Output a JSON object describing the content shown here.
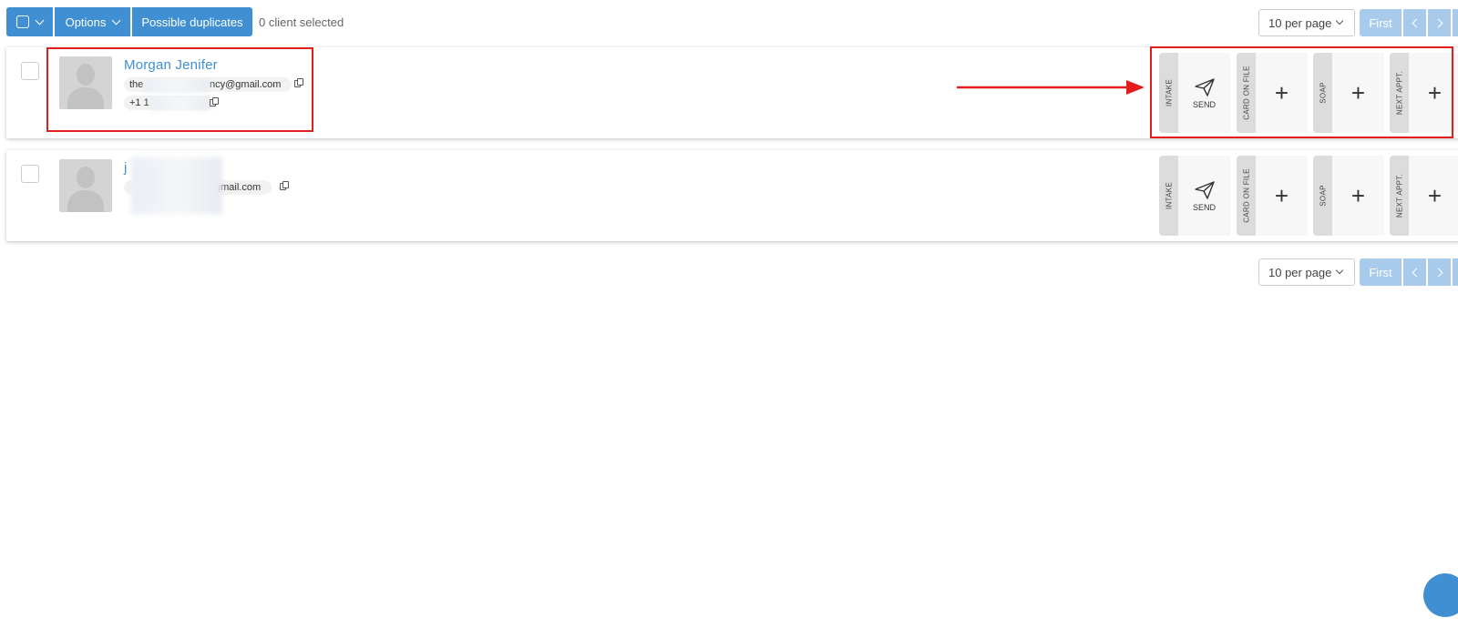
{
  "toolbar": {
    "options_label": "Options",
    "duplicates_label": "Possible duplicates",
    "selected_text": "0 client selected",
    "per_page": "10 per page",
    "first_label": "First"
  },
  "clients": [
    {
      "name": "Morgan Jenifer",
      "email_start": "the",
      "email_end": "ncy@gmail.com",
      "phone_start": "+1 1"
    },
    {
      "name": "j",
      "email_end": "gmail.com"
    }
  ],
  "actions": {
    "intake": "INTAKE",
    "send": "SEND",
    "card_on_file": "CARD ON FILE",
    "soap": "SOAP",
    "next_appt": "NEXT APPT.",
    "plus": "+"
  },
  "colors": {
    "accent": "#3f8fd2",
    "pager_disabled": "#a9cbeb",
    "annotation": "#e31c1c"
  },
  "icons": [
    "checkbox-icon",
    "chevron-down-icon",
    "copy-icon",
    "paper-plane-icon",
    "plus-icon",
    "chevron-left-icon",
    "chevron-right-icon",
    "avatar-placeholder-icon"
  ]
}
